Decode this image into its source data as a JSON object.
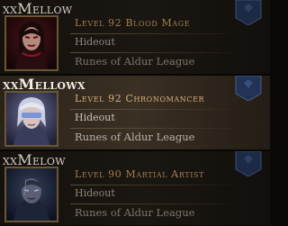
{
  "characters": [
    {
      "name": "xxMellow",
      "level_text": "Level 92 Blood Mage",
      "location": "Hideout",
      "league": "Runes of Aldur League",
      "portrait_icon": "blood-mage-portrait",
      "selected": false
    },
    {
      "name": "xxMellowx",
      "level_text": "Level 92 Chronomancer",
      "location": "Hideout",
      "league": "Runes of Aldur League",
      "portrait_icon": "chronomancer-portrait",
      "selected": true
    },
    {
      "name": "xxMelow",
      "level_text": "Level 90 Martial Artist",
      "location": "Hideout",
      "league": "Runes of Aldur League",
      "portrait_icon": "martial-artist-portrait",
      "selected": false
    }
  ],
  "colors": {
    "name_text": "#d6d2c8",
    "level_text": "#a27f4f",
    "frame_gold": "#6b5633",
    "banner_blue": "#1d2a45"
  }
}
